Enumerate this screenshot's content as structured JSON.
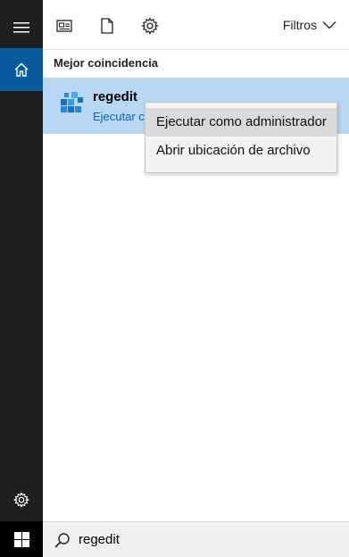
{
  "rail": {
    "items": [
      {
        "name": "menu",
        "icon": "hamburger-icon"
      },
      {
        "name": "home",
        "icon": "home-icon",
        "active": true
      },
      {
        "name": "settings",
        "icon": "gear-icon"
      }
    ],
    "accent": "#0a5a9e",
    "background": "#1f1f1f"
  },
  "toolbar": {
    "icons": [
      "apps-icon",
      "document-icon",
      "gear-icon"
    ],
    "filters_label": "Filtros"
  },
  "section": {
    "title": "Mejor coincidencia"
  },
  "result": {
    "name": "regedit",
    "subtitle": "Ejecutar co",
    "icon": "registry-editor-icon",
    "highlight_color": "#b7d7f3"
  },
  "context_menu": {
    "items": [
      {
        "label": "Ejecutar como administrador",
        "hovered": true
      },
      {
        "label": "Abrir ubicación de archivo",
        "hovered": false
      }
    ]
  },
  "search": {
    "value": "regedit"
  }
}
